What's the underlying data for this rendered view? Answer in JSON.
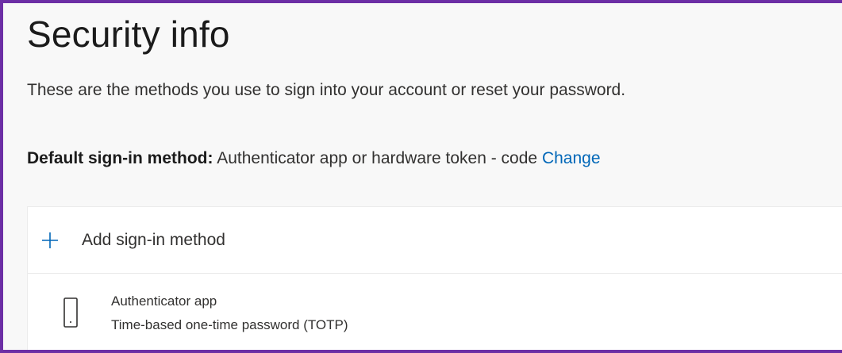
{
  "page": {
    "title": "Security info",
    "subtitle": "These are the methods you use to sign into your account or reset your password."
  },
  "default_method": {
    "label": "Default sign-in method:",
    "value": "Authenticator app or hardware token - code",
    "change_link": "Change"
  },
  "methods_list": {
    "add_label": "Add sign-in method",
    "add_icon": "plus-icon",
    "items": [
      {
        "icon": "phone-icon",
        "name": "Authenticator app",
        "detail": "Time-based one-time password (TOTP)"
      }
    ]
  },
  "colors": {
    "frame_border": "#6c2fa5",
    "link": "#0067b8",
    "accent": "#0067b8",
    "page_background": "#f8f8f8"
  }
}
